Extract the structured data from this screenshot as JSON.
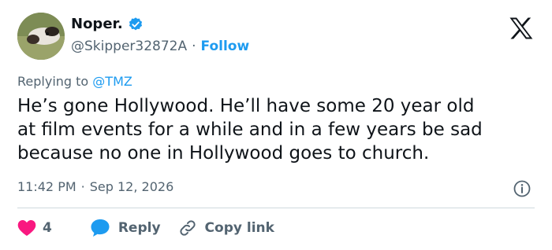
{
  "author": {
    "name": "Noper.",
    "handle": "@Skipper32872A",
    "separator": "·",
    "follow_label": "Follow",
    "verified": true
  },
  "reply_context": {
    "prefix": "Replying to",
    "mention": "@TMZ"
  },
  "tweet": {
    "text": "He’s gone Hollywood. He’ll have some 20 year old\nat film events for a while and in a few years be sad\nbecause no one in Hollywood goes to church.",
    "time": "11:42 PM",
    "separator": "·",
    "date": "Sep 12, 2026"
  },
  "actions": {
    "like_count": "4",
    "reply_label": "Reply",
    "copy_link_label": "Copy link"
  },
  "colors": {
    "accent": "#1d9bf0",
    "like": "#f91880",
    "text": "#0f1419",
    "muted": "#536471"
  },
  "icons": {
    "verified": "verified-badge-icon",
    "logo": "x-logo-icon",
    "info": "info-icon",
    "like": "heart-icon",
    "reply": "reply-bubble-icon",
    "link": "link-icon"
  }
}
